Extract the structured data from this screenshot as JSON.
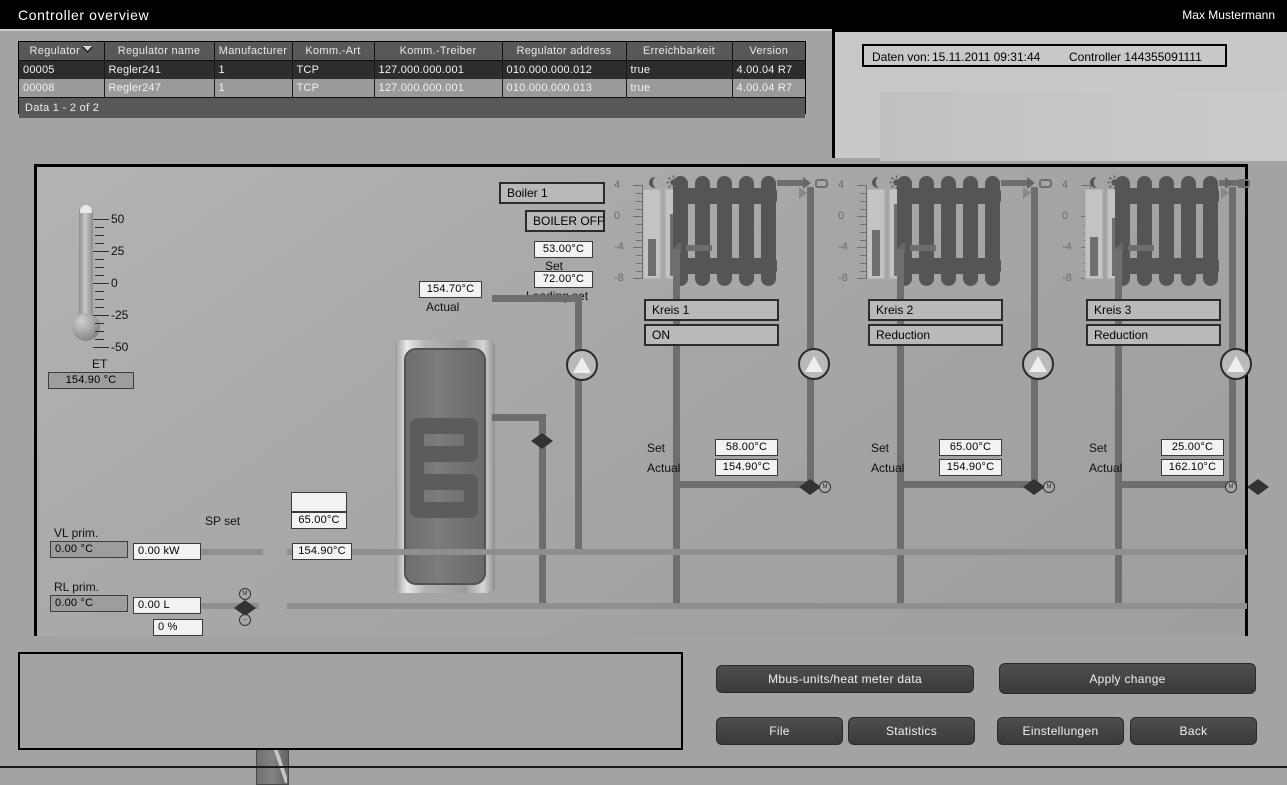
{
  "titlebar": {
    "title": "Controller overview",
    "user": "Max Mustermann"
  },
  "grid": {
    "columns": [
      "Regulator",
      "Regulator name",
      "Manufacturer",
      "Komm.-Art",
      "Komm.-Treiber",
      "Regulator address",
      "Erreichbarkeit",
      "Version"
    ],
    "rows": [
      [
        "00005",
        "Regler241",
        "1",
        "TCP",
        "127.000.000.001",
        "010.000.000.012",
        "true",
        "4.00.04 R7"
      ],
      [
        "00008",
        "Regler247",
        "1",
        "TCP",
        "127.000.000.001",
        "010.000.000.013",
        "true",
        "4.00.04 R7"
      ]
    ],
    "footer": "Data 1 - 2 of 2",
    "sort_icon": "sort-descending-icon"
  },
  "info": {
    "label": "Daten von:",
    "datetime": "15.11.2011 09:31:44",
    "controller": "Controller 144355091111"
  },
  "outside": {
    "thermometer_ticks": [
      "50",
      "25",
      "0",
      "-25",
      "-50"
    ],
    "label": "ET",
    "value": "154.90 °C"
  },
  "boiler": {
    "name": "Boiler 1",
    "state": "BOILER OFF",
    "set_value": "53.00°C",
    "set_label": "Set",
    "loading_set_value": "72.00°C",
    "loading_set_label": "Loading set",
    "actual_value": "154.70°C",
    "actual_label": "Actual"
  },
  "primary": {
    "vl_label": "VL prim.",
    "vl_value": "0.00      °C",
    "rl_label": "RL prim.",
    "rl_value": "0.00      °C",
    "power_value": "0.00      kW",
    "flow_value": "0.00      L",
    "percent_value": "0        %",
    "sp_set_label": "SP set",
    "sp_set_value": "65.00°C",
    "sp_blank_value": "",
    "secondary_value": "154.90°C"
  },
  "circuits": [
    {
      "name": "Kreis 1",
      "state": "ON",
      "set_label": "Set",
      "set_value": "58.00°C",
      "actual_label": "Actual",
      "actual_value": "154.90°C",
      "scale_ticks": [
        "4",
        "0",
        "-4",
        "-8"
      ],
      "night_icon": "moon-icon",
      "day_icon": "sun-icon",
      "night_bar_pct": 42,
      "day_bar_pct": 70
    },
    {
      "name": "Kreis 2",
      "state": "Reduction",
      "set_label": "Set",
      "set_value": "65.00°C",
      "actual_label": "Actual",
      "actual_value": "154.90°C",
      "scale_ticks": [
        "4",
        "0",
        "-4",
        "-8"
      ],
      "night_icon": "moon-icon",
      "day_icon": "sun-icon",
      "night_bar_pct": 52,
      "day_bar_pct": 82
    },
    {
      "name": "Kreis 3",
      "state": "Reduction",
      "set_label": "Set",
      "set_value": "25.00°C",
      "actual_label": "Actual",
      "actual_value": "162.10°C",
      "scale_ticks": [
        "4",
        "0",
        "-4",
        "-8"
      ],
      "night_icon": "moon-icon",
      "day_icon": "sun-icon",
      "night_bar_pct": 44,
      "day_bar_pct": 66
    }
  ],
  "buttons": {
    "mbus": "Mbus-units/heat meter data",
    "apply": "Apply change",
    "file": "File",
    "statistics": "Statistics",
    "settings": "Einstellungen",
    "back": "Back"
  },
  "colors": {
    "window_bg": "#a3a3a3",
    "titlebar_bg": "#000000",
    "grid_header": "#585858",
    "row_selected": "#2d2d2d",
    "field_bg": "#f2f2f2",
    "pipe": "#6e6e6e",
    "button": "#444444"
  }
}
